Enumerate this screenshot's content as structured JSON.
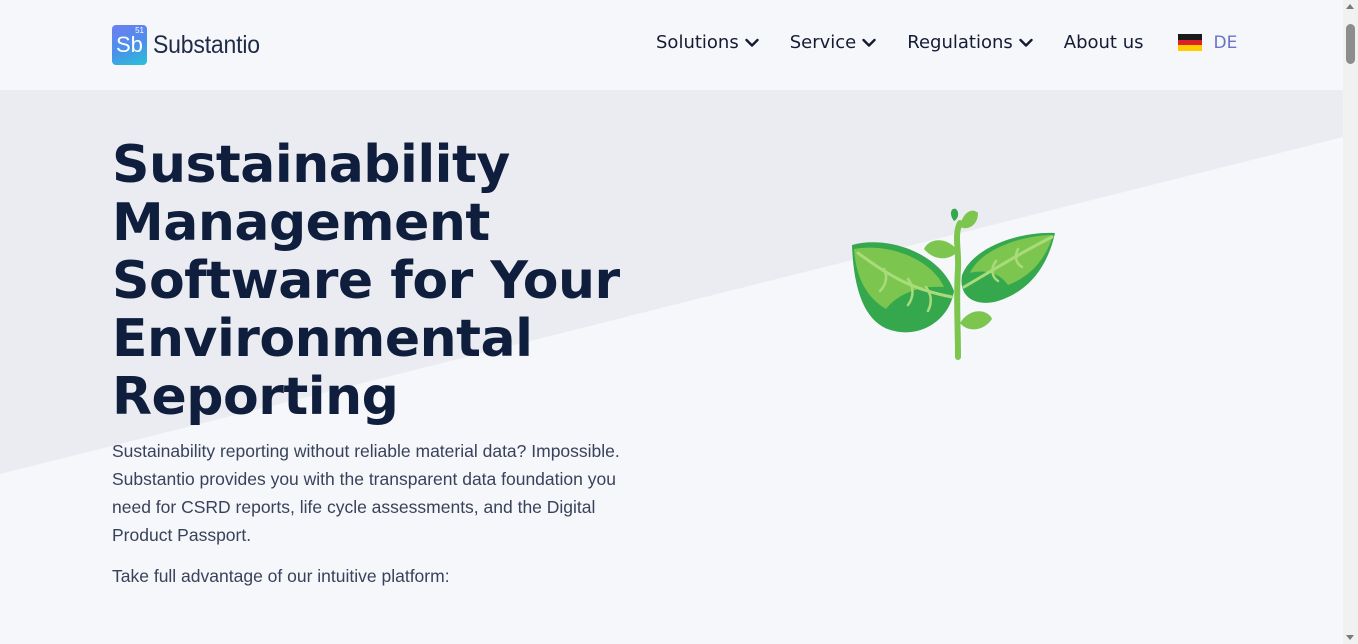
{
  "header": {
    "logo": {
      "symbol": "Sb",
      "number": "51",
      "name": "Substantio"
    },
    "nav": {
      "solutions": "Solutions",
      "service": "Service",
      "regulations": "Regulations",
      "about": "About us"
    },
    "language": {
      "label": "DE",
      "flag_icon": "germany-flag-icon"
    }
  },
  "hero": {
    "title": "Sustainability Management Software for Your Environmental Reporting",
    "description": "Sustainability reporting without reliable material data? Impossible. Substantio provides you with the transparent data foundation you need for CSRD reports, life cycle assessments, and the Digital Product Passport.",
    "subtext": "Take full advantage of our intuitive platform:",
    "illustration_icon": "plant-sprout-icon"
  },
  "colors": {
    "heading": "#0f1e3d",
    "nav_text": "#141b33",
    "language_accent": "#6b73c9",
    "background": "#f5f7fb",
    "band": "#ebecf1",
    "leaf_dark": "#35a84e",
    "leaf_light": "#7cc650"
  }
}
